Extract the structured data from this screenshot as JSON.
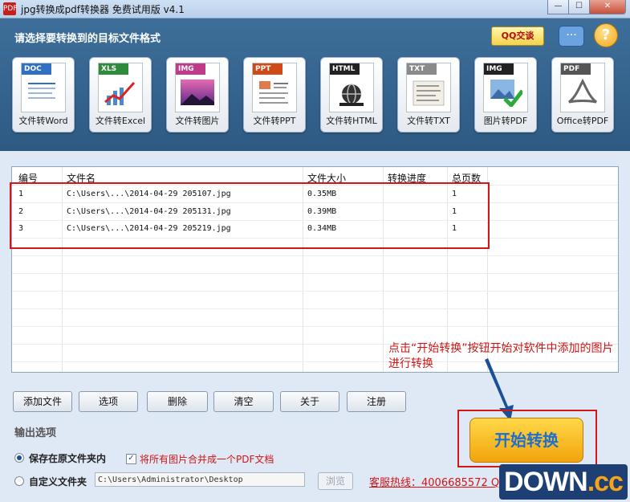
{
  "window": {
    "title": "jpg转换成pdf转换器 免费试用版 v4.1",
    "minimize": "—",
    "maximize": "☐",
    "close": "✕",
    "app_icon": "PDF"
  },
  "header": {
    "label": "请选择要转换到的目标文件格式",
    "qq_label": "QQ交谈",
    "chat_icon": "speech-bubble-icon",
    "help_icon": "question-icon",
    "help_glyph": "?",
    "chat_glyph": "···"
  },
  "tools": [
    {
      "tag": "DOC",
      "label": "文件转Word",
      "color": "#2f6fc4"
    },
    {
      "tag": "XLS",
      "label": "文件转Excel",
      "color": "#2e8b3a"
    },
    {
      "tag": "IMG",
      "label": "文件转图片",
      "color": "#c13a8a"
    },
    {
      "tag": "PPT",
      "label": "文件转PPT",
      "color": "#d04a18"
    },
    {
      "tag": "HTML",
      "label": "文件转HTML",
      "color": "#222222"
    },
    {
      "tag": "TXT",
      "label": "文件转TXT",
      "color": "#8a8a8a"
    },
    {
      "tag": "IMG",
      "label": "图片转PDF",
      "color": "#222222"
    },
    {
      "tag": "PDF",
      "label": "Office转PDF",
      "color": "#555555"
    }
  ],
  "table": {
    "headers": [
      "编号",
      "文件名",
      "文件大小",
      "转换进度",
      "总页数"
    ],
    "rows": [
      [
        "1",
        "C:\\Users\\...\\2014-04-29 205107.jpg",
        "0.35MB",
        "",
        "1"
      ],
      [
        "2",
        "C:\\Users\\...\\2014-04-29 205131.jpg",
        "0.39MB",
        "",
        "1"
      ],
      [
        "3",
        "C:\\Users\\...\\2014-04-29 205219.jpg",
        "0.34MB",
        "",
        "1"
      ]
    ]
  },
  "annotation": "点击“开始转换”按钮开始对软件中添加的图片进行转换",
  "buttons": {
    "add": "添加文件",
    "options": "选项",
    "delete": "删除",
    "clear": "清空",
    "about": "关于",
    "register": "注册"
  },
  "output": {
    "section_label": "输出选项",
    "save_original": "保存在原文件夹内",
    "merge_label": "将所有图片合并成一个PDF文档",
    "merge_checked": "✓",
    "custom_folder": "自定义文件夹",
    "path_value": "C:\\Users\\Administrator\\Desktop",
    "browse": "浏览"
  },
  "start_button": "开始转换",
  "hotline": "客服热线：4006685572 QQ",
  "watermark": {
    "main": "DOWN",
    "suffix": ".cc"
  }
}
